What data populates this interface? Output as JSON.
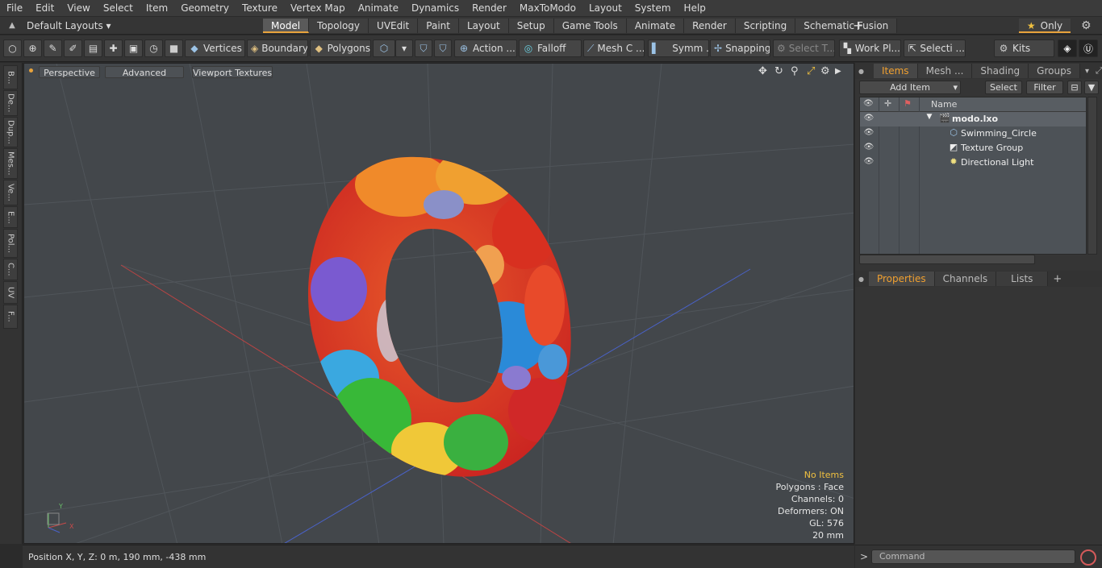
{
  "menu": [
    "File",
    "Edit",
    "View",
    "Select",
    "Item",
    "Geometry",
    "Texture",
    "Vertex Map",
    "Animate",
    "Dynamics",
    "Render",
    "MaxToModo",
    "Layout",
    "System",
    "Help"
  ],
  "layout_row": {
    "layouts_label": "Default Layouts ▾",
    "tabs": [
      "Model",
      "Topology",
      "UVEdit",
      "Paint",
      "Layout",
      "Setup",
      "Game Tools",
      "Animate",
      "Render",
      "Scripting",
      "Schematic Fusion"
    ],
    "active_tab": "Model",
    "plus": "+",
    "only_label": "Only",
    "star": "★"
  },
  "toolbar": {
    "vertices": "Vertices",
    "boundary": "Boundary",
    "polygons": "Polygons",
    "action": "Action ...",
    "falloff": "Falloff",
    "mesh": "Mesh C ...",
    "symm": "Symm ...",
    "snapping": "Snapping",
    "select_t": "Select T...",
    "workpl": "Work Pl...",
    "selecti": "Selecti ...",
    "kits": "Kits"
  },
  "left_tabs": [
    "B...",
    "De...",
    "Dup...",
    "Mes...",
    "Ve...",
    "E...",
    "Pol...",
    "C...",
    "UV",
    "F..."
  ],
  "viewport": {
    "perspective": "Perspective",
    "advanced": "Advanced",
    "viewport_textures": "Viewport Textures",
    "stats": {
      "no_items": "No Items",
      "polygons": "Polygons : Face",
      "channels": "Channels: 0",
      "deformers": "Deformers: ON",
      "gl": "GL: 576",
      "scale": "20 mm"
    },
    "axis": {
      "y": "Y",
      "x": "X"
    }
  },
  "status": {
    "position": "Position X, Y, Z:   0 m, 190 mm, -438 mm"
  },
  "items_panel": {
    "tabs": [
      "Items",
      "Mesh ...",
      "Shading",
      "Groups"
    ],
    "active_tab": "Items",
    "add_item": "Add Item",
    "select": "Select",
    "filter": "Filter",
    "name_header": "Name",
    "rows": [
      {
        "name": "modo.lxo",
        "icon": "scene-icon",
        "bold": true
      },
      {
        "name": "Swimming_Circle",
        "icon": "mesh-icon",
        "bold": false
      },
      {
        "name": "Texture Group",
        "icon": "texture-group-icon",
        "bold": false
      },
      {
        "name": "Directional Light",
        "icon": "light-icon",
        "bold": false
      }
    ]
  },
  "properties_panel": {
    "tabs": [
      "Properties",
      "Channels",
      "Lists"
    ],
    "active_tab": "Properties",
    "plus": "+"
  },
  "command": {
    "placeholder": "Command",
    "prompt": ">"
  },
  "colors": {
    "accent": "#e8a33c",
    "viewport_bg": "#43474b",
    "panel_bg": "#353535"
  }
}
